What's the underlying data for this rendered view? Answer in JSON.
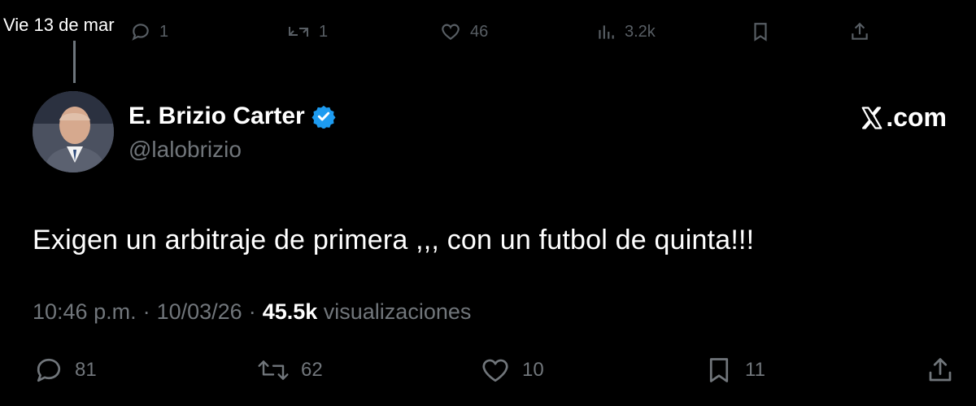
{
  "date_stamp": "Vie 13 de mar",
  "previous_tweet_actions": {
    "replies": "1",
    "retweets": "1",
    "likes": "46",
    "views": "3.2k"
  },
  "tweet": {
    "author": {
      "display_name": "E. Brizio Carter",
      "handle": "@lalobrizio",
      "verified": true,
      "badge_color": "#1d9bf0"
    },
    "brand_label": ".com",
    "text": "Exigen un arbitraje de primera ,,, con un futbol de quinta!!!",
    "time": "10:46 p.m.",
    "date": "10/03/26",
    "views_count": "45.5k",
    "views_label": "visualizaciones",
    "sep": "·",
    "actions": {
      "replies": "81",
      "retweets": "62",
      "likes": "10",
      "bookmarks": "11"
    }
  }
}
